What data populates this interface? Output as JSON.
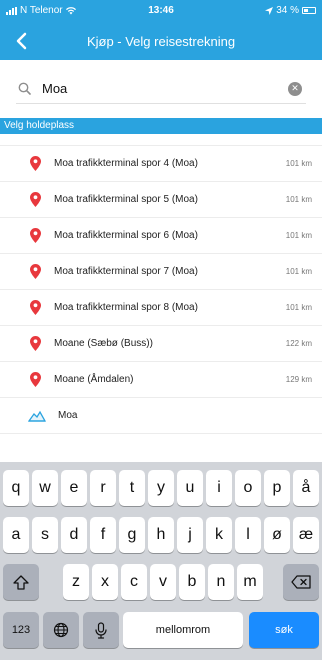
{
  "status": {
    "carrier": "N Telenor",
    "time": "13:46",
    "battery": "34 %"
  },
  "nav": {
    "title": "Kjøp - Velg reisestrekning"
  },
  "search": {
    "value": "Moa"
  },
  "section": {
    "title": "Velg holdeplass"
  },
  "stops": [
    {
      "name": "Moa trafikkterminal spor 4 (Moa)",
      "dist": "101 km"
    },
    {
      "name": "Moa trafikkterminal spor 5 (Moa)",
      "dist": "101 km"
    },
    {
      "name": "Moa trafikkterminal spor 6 (Moa)",
      "dist": "101 km"
    },
    {
      "name": "Moa trafikkterminal spor 7 (Moa)",
      "dist": "101 km"
    },
    {
      "name": "Moa trafikkterminal spor 8 (Moa)",
      "dist": "101 km"
    },
    {
      "name": "Moane (Sæbø (Buss))",
      "dist": "122 km"
    },
    {
      "name": "Moane (Åmdalen)",
      "dist": "129 km"
    }
  ],
  "area": {
    "name": "Moa"
  },
  "keyboard": {
    "row1": [
      "q",
      "w",
      "e",
      "r",
      "t",
      "y",
      "u",
      "i",
      "o",
      "p",
      "å"
    ],
    "row2": [
      "a",
      "s",
      "d",
      "f",
      "g",
      "h",
      "j",
      "k",
      "l",
      "ø",
      "æ"
    ],
    "row3": [
      "z",
      "x",
      "c",
      "v",
      "b",
      "n",
      "m"
    ],
    "numbers": "123",
    "space": "mellomrom",
    "submit": "søk"
  },
  "colors": {
    "brand": "#2aa3df",
    "pin": "#e8383d",
    "submit": "#1a8cff"
  }
}
